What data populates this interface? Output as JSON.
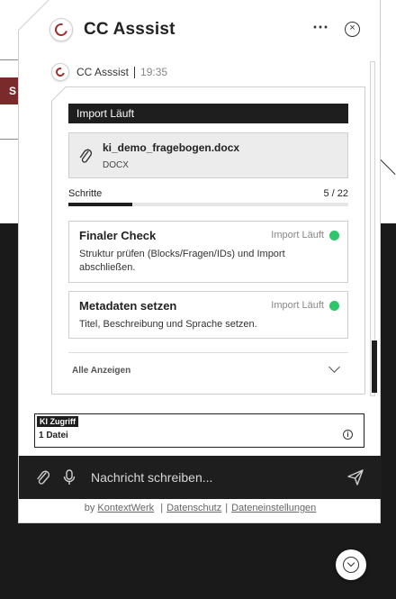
{
  "header": {
    "title": "CC Asssist",
    "menu_icon": "⋯",
    "close_icon": "×"
  },
  "message": {
    "sender": "CC Asssist",
    "time": "19:35"
  },
  "import": {
    "status_label": "Import Läuft",
    "file_name": "ki_demo_fragebogen.docx",
    "file_type": "DOCX",
    "steps_label": "Schritte",
    "steps_count": "5 / 22",
    "progress_fraction": 0.227,
    "steps": [
      {
        "title": "Finaler Check",
        "status": "Import Läuft",
        "description": "Struktur prüfen (Blocks/Fragen/IDs) und Import abschließen."
      },
      {
        "title": "Metadaten setzen",
        "status": "Import Läuft",
        "description": "Titel, Beschreibung und Sprache setzen."
      }
    ],
    "show_all": "Alle Anzeigen"
  },
  "ki_access": {
    "badge": "KI Zugriff",
    "files": "1 Datei",
    "info_icon": "i"
  },
  "composer": {
    "placeholder": "Nachricht schreiben..."
  },
  "footer": {
    "prefix": "by",
    "brand": "KontextWerk",
    "privacy": "Datenschutz",
    "file_settings": "Dateneinstellungen",
    "separator": "|"
  },
  "background": {
    "tab_letter": "S"
  },
  "colors": {
    "accent": "#1e1e1e",
    "status_green": "#2fc56a",
    "brand_red": "#a52a2a"
  }
}
